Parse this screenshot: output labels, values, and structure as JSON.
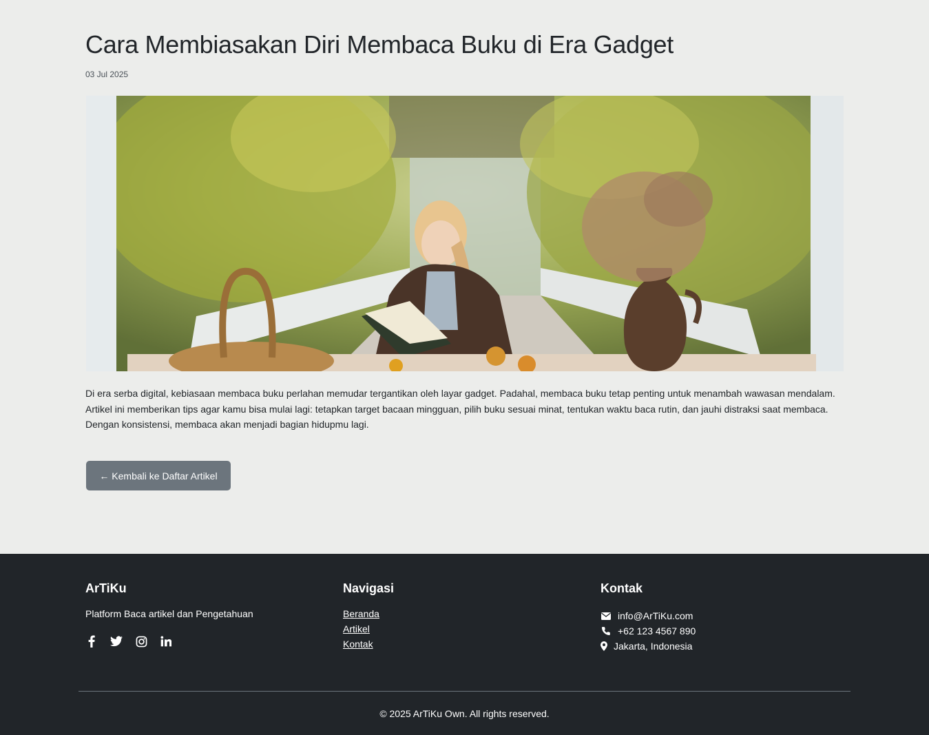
{
  "article": {
    "title": "Cara Membiasakan Diri Membaca Buku di Era Gadget",
    "date": "03 Jul 2025",
    "image_alt": "woman-reading-book-photo",
    "body": "Di era serba digital, kebiasaan membaca buku perlahan memudar tergantikan oleh layar gadget. Padahal, membaca buku tetap penting untuk menambah wawasan mendalam. Artikel ini memberikan tips agar kamu bisa mulai lagi: tetapkan target bacaan mingguan, pilih buku sesuai minat, tentukan waktu baca rutin, dan jauhi distraksi saat membaca. Dengan konsistensi, membaca akan menjadi bagian hidupmu lagi.",
    "back_button": "← Kembali ke Daftar Artikel"
  },
  "footer": {
    "brand": {
      "title": "ArTiKu",
      "tagline": "Platform Baca artikel dan Pengetahuan",
      "socials": [
        "facebook-icon",
        "twitter-icon",
        "instagram-icon",
        "linkedin-icon"
      ]
    },
    "nav": {
      "title": "Navigasi",
      "links": [
        "Beranda",
        "Artikel",
        "Kontak"
      ]
    },
    "contact": {
      "title": "Kontak",
      "email": "info@ArTiKu.com",
      "phone": "+62 123 4567 890",
      "location": "Jakarta, Indonesia"
    },
    "copyright": "© 2025 ArTiKu Own. All rights reserved."
  },
  "colors": {
    "background": "#ecedeb",
    "footer_bg": "#212529",
    "button_bg": "#6c757d",
    "text": "#212529"
  }
}
